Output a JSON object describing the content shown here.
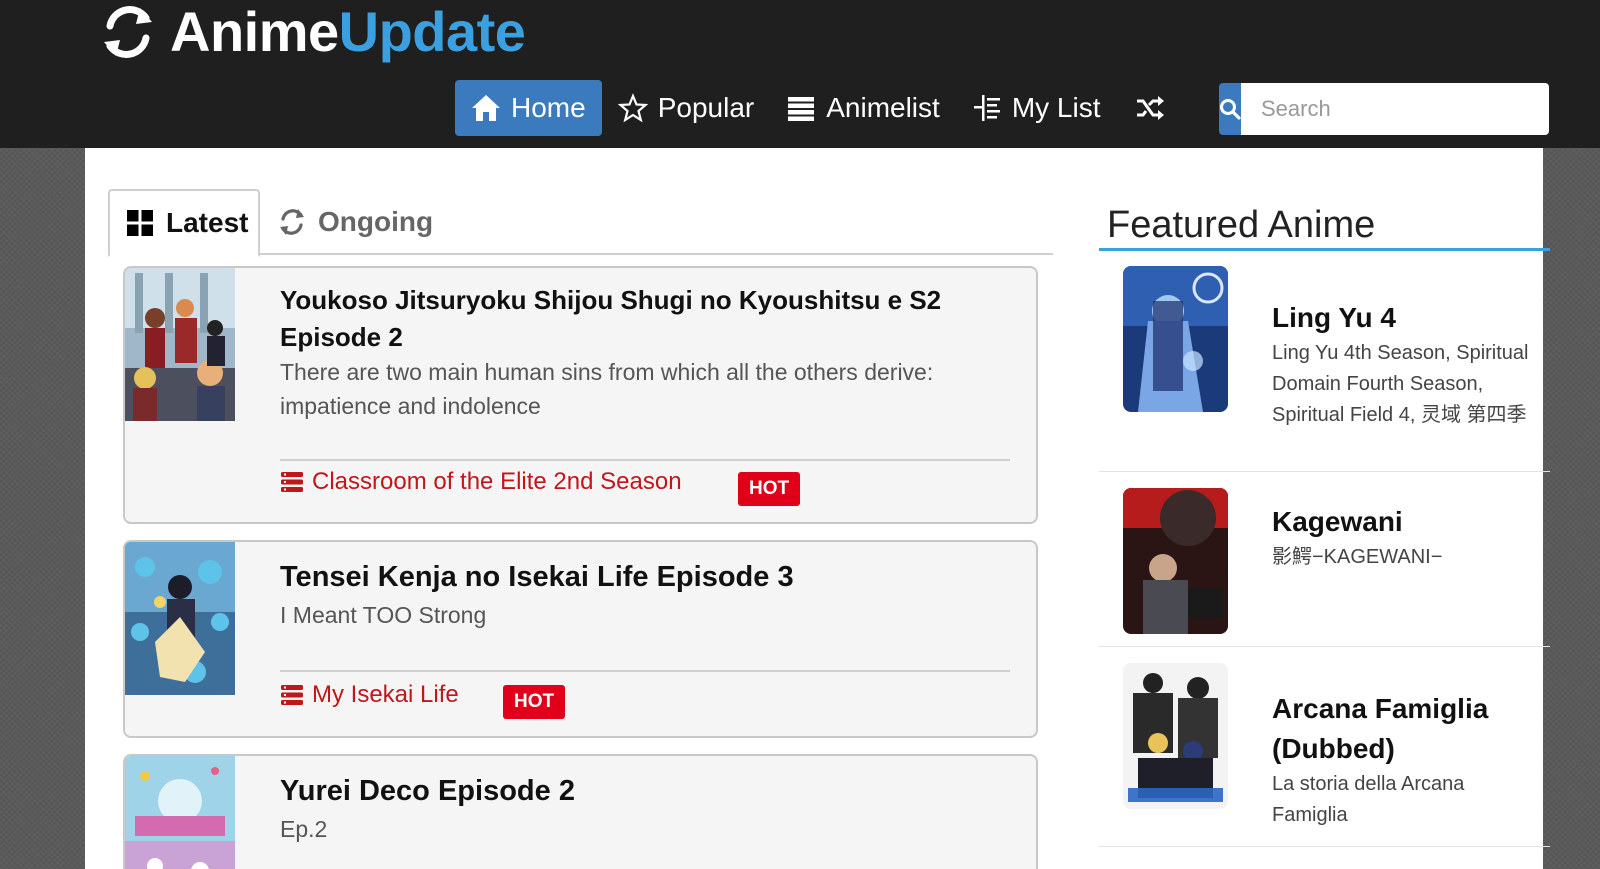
{
  "header": {
    "logo_part1": "Anime",
    "logo_part2": "Update",
    "nav": [
      {
        "label": "Home",
        "icon": "home-icon"
      },
      {
        "label": "Popular",
        "icon": "star-icon"
      },
      {
        "label": "Animelist",
        "icon": "list-icon"
      },
      {
        "label": "My List",
        "icon": "tree-list-icon"
      }
    ],
    "search_placeholder": "Search"
  },
  "tabs": [
    {
      "label": "Latest",
      "icon": "grid-icon"
    },
    {
      "label": "Ongoing",
      "icon": "refresh-icon"
    }
  ],
  "latest": [
    {
      "title": "Youkoso Jitsuryoku Shijou Shugi no Kyoushitsu e S2 Episode 2",
      "description": "There are two main human sins from which all the others derive: impatience and indolence",
      "series": "Classroom of the Elite 2nd Season",
      "badge": "HOT"
    },
    {
      "title": "Tensei Kenja no Isekai Life Episode 3",
      "description": "I Meant TOO Strong",
      "series": "My Isekai Life",
      "badge": "HOT"
    },
    {
      "title": "Yurei Deco Episode 2",
      "description": "Ep.2"
    }
  ],
  "featured": {
    "title": "Featured Anime",
    "items": [
      {
        "name": "Ling Yu 4",
        "alt": "Ling Yu 4th Season, Spiritual Domain Fourth Season, Spiritual Field 4, 灵域 第四季"
      },
      {
        "name": "Kagewani",
        "alt": "影鰐−KAGEWANI−"
      },
      {
        "name": "Arcana Famiglia (Dubbed)",
        "alt": "La storia della Arcana Famiglia"
      }
    ]
  },
  "colors": {
    "header_bg": "#1f1f1f",
    "accent_blue": "#3b7bbd",
    "logo_blue": "#3aa0e0",
    "link_red": "#c0171b",
    "badge_red": "#e0001a"
  }
}
